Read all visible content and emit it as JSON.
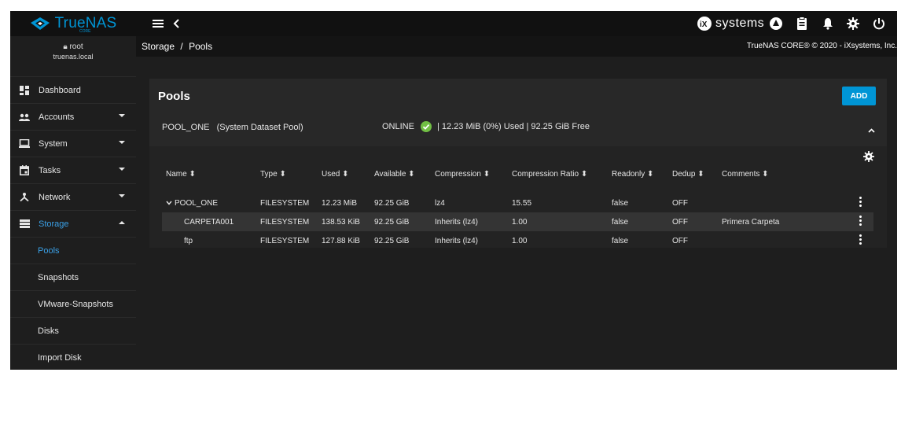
{
  "brand": {
    "name": "TrueNAS",
    "edition": "CORE"
  },
  "topbar": {
    "vendor": "systems",
    "icons": [
      "menu-icon",
      "back-chevron-icon",
      "ix-logo",
      "truecommand-icon",
      "clipboard-icon",
      "bell-icon",
      "gear-icon",
      "power-icon"
    ]
  },
  "user": {
    "name": "root",
    "host": "truenas.local"
  },
  "sidebar": {
    "items": [
      {
        "label": "Dashboard",
        "icon": "dashboard-icon"
      },
      {
        "label": "Accounts",
        "icon": "accounts-icon"
      },
      {
        "label": "System",
        "icon": "system-icon"
      },
      {
        "label": "Tasks",
        "icon": "tasks-icon"
      },
      {
        "label": "Network",
        "icon": "network-icon"
      },
      {
        "label": "Storage",
        "icon": "storage-icon"
      }
    ],
    "storage_sub": [
      "Pools",
      "Snapshots",
      "VMware-Snapshots",
      "Disks",
      "Import Disk"
    ]
  },
  "breadcrumb": {
    "parent": "Storage",
    "sep": "/",
    "current": "Pools"
  },
  "copyright": "TrueNAS CORE® © 2020 - iXsystems, Inc.",
  "card": {
    "title": "Pools",
    "add_label": "ADD",
    "pool_name": "POOL_ONE",
    "pool_note": "(System Dataset Pool)",
    "status": "ONLINE",
    "usage": "| 12.23 MiB (0%) Used | 92.25 GiB Free"
  },
  "table": {
    "headers": [
      "Name",
      "Type",
      "Used",
      "Available",
      "Compression",
      "Compression Ratio",
      "Readonly",
      "Dedup",
      "Comments"
    ],
    "rows": [
      {
        "name": "POOL_ONE",
        "type": "FILESYSTEM",
        "used": "12.23 MiB",
        "available": "92.25 GiB",
        "compression": "lz4",
        "ratio": "15.55",
        "readonly": "false",
        "dedup": "OFF",
        "comments": ""
      },
      {
        "name": "CARPETA001",
        "type": "FILESYSTEM",
        "used": "138.53 KiB",
        "available": "92.25 GiB",
        "compression": "Inherits (lz4)",
        "ratio": "1.00",
        "readonly": "false",
        "dedup": "OFF",
        "comments": "Primera Carpeta"
      },
      {
        "name": "ftp",
        "type": "FILESYSTEM",
        "used": "127.88 KiB",
        "available": "92.25 GiB",
        "compression": "Inherits (lz4)",
        "ratio": "1.00",
        "readonly": "false",
        "dedup": "OFF",
        "comments": ""
      }
    ]
  },
  "colors": {
    "accent": "#0095d5",
    "active_nav": "#3aa0e6",
    "online": "#71bf44"
  }
}
